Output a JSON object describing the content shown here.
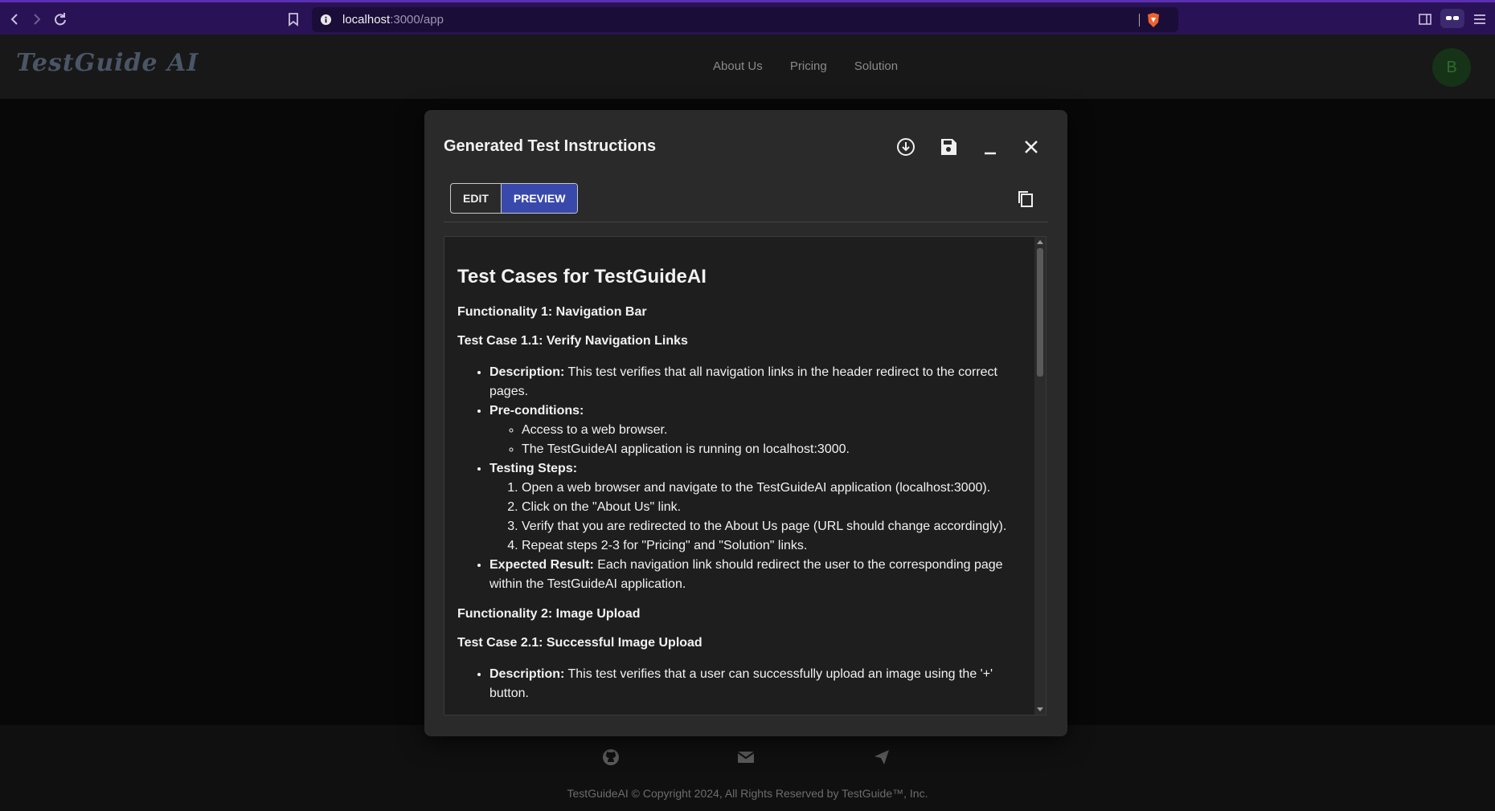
{
  "browser": {
    "url_host": "localhost",
    "url_path": ":3000/app"
  },
  "header": {
    "logo": "TestGuide AI",
    "nav": [
      "About Us",
      "Pricing",
      "Solution"
    ],
    "avatar_initial": "B"
  },
  "modal": {
    "title": "Generated Test Instructions",
    "tabs": {
      "edit": "EDIT",
      "preview": "PREVIEW",
      "active": "preview"
    },
    "doc": {
      "heading": "Test Cases for TestGuideAI",
      "func1": "Functionality 1: Navigation Bar",
      "tc11": "Test Case 1.1: Verify Navigation Links",
      "desc_label": "Description:",
      "desc_text": " This test verifies that all navigation links in the header redirect to the correct pages.",
      "pre_label": "Pre-conditions:",
      "pre_items": [
        "Access to a web browser.",
        "The TestGuideAI application is running on localhost:3000."
      ],
      "steps_label": "Testing Steps:",
      "steps": [
        "Open a web browser and navigate to the TestGuideAI application (localhost:3000).",
        "Click on the \"About Us\" link.",
        "Verify that you are redirected to the About Us page (URL should change accordingly).",
        "Repeat steps 2-3 for \"Pricing\" and \"Solution\" links."
      ],
      "expected_label": "Expected Result:",
      "expected_text": " Each navigation link should redirect the user to the corresponding page within the TestGuideAI application.",
      "func2": "Functionality 2: Image Upload",
      "tc21": "Test Case 2.1: Successful Image Upload",
      "desc2_label": "Description:",
      "desc2_text": " This test verifies that a user can successfully upload an image using the '+' button."
    }
  },
  "footer": {
    "copyright": "TestGuideAI © Copyright 2024, All Rights Reserved by TestGuide™, Inc."
  },
  "icons": [
    "back-icon",
    "forward-icon",
    "reload-icon",
    "bookmark-icon",
    "info-icon",
    "brave-shield-icon",
    "sidebar-icon",
    "extension-icon",
    "menu-icon",
    "download-icon",
    "save-icon",
    "minimize-icon",
    "close-icon",
    "copy-icon",
    "github-icon",
    "mail-icon",
    "send-icon"
  ]
}
